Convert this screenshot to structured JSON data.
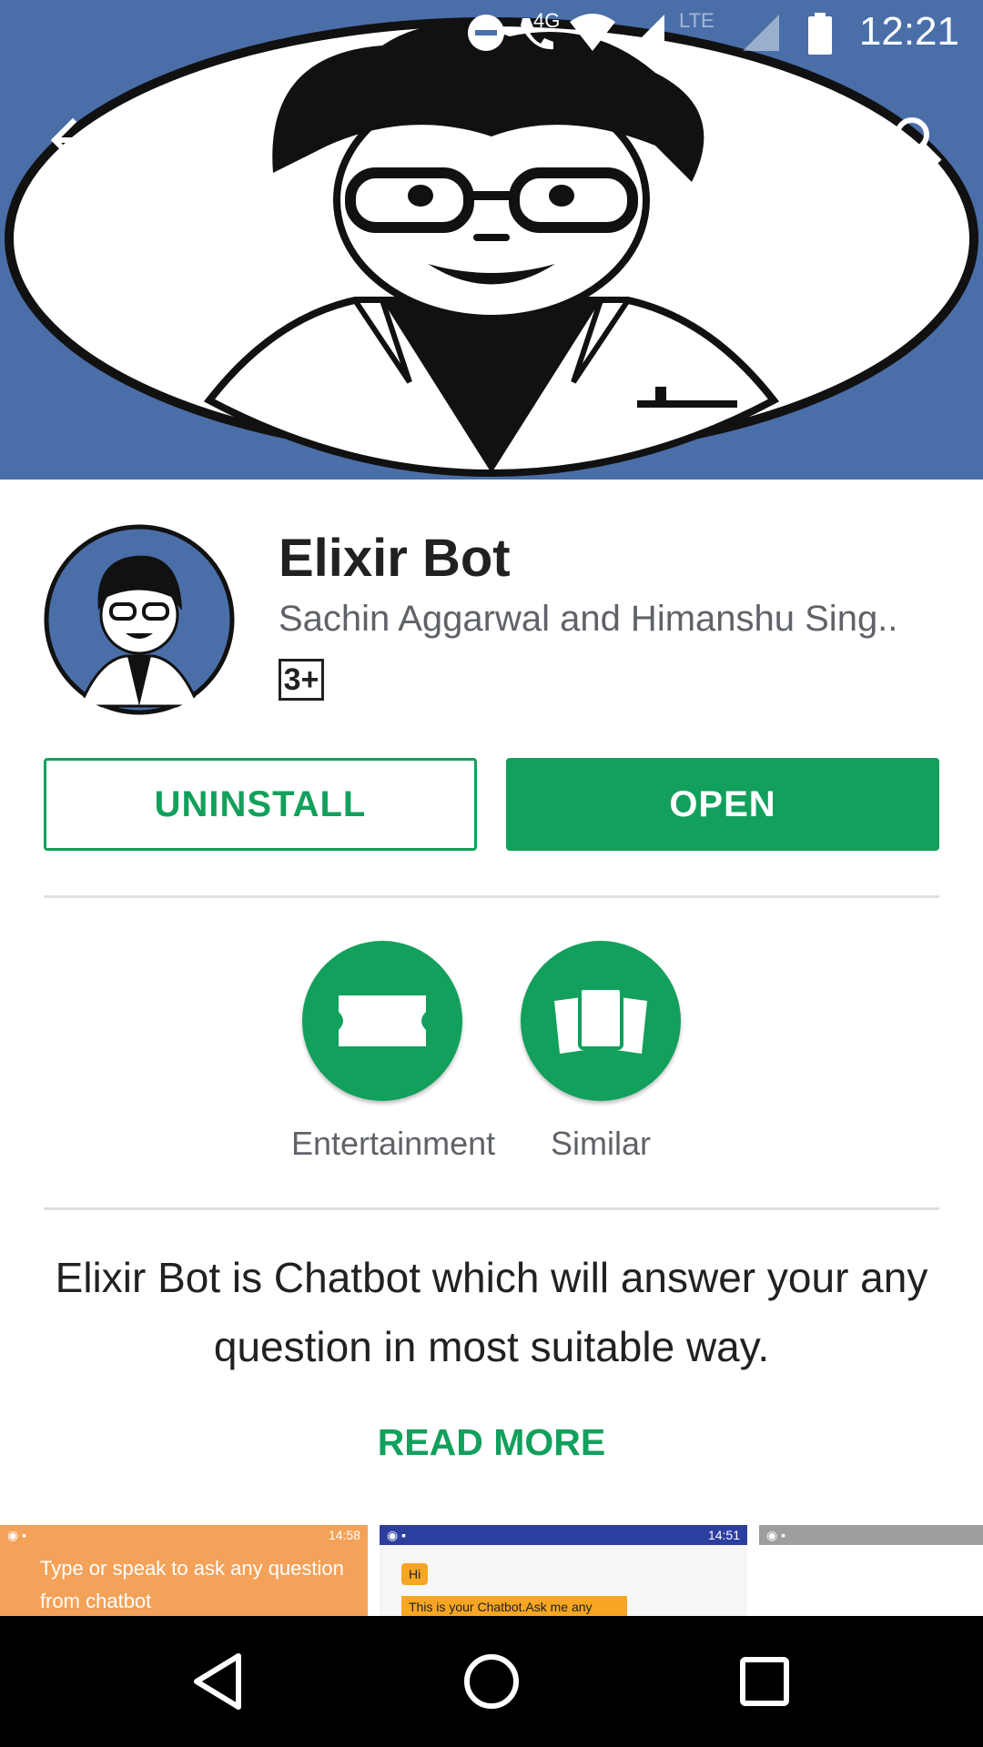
{
  "status_bar": {
    "time": "12:21",
    "network": "4G",
    "network2": "LTE"
  },
  "toolbar": {
    "back_icon": "arrow-left-icon",
    "search_icon": "search-icon"
  },
  "app": {
    "title": "Elixir Bot",
    "developer": "Sachin Aggarwal and Himanshu Sing..",
    "rating": "3+"
  },
  "actions": {
    "uninstall_label": "UNINSTALL",
    "open_label": "OPEN"
  },
  "chips": [
    {
      "label": "Entertainment",
      "icon": "ticket-icon"
    },
    {
      "label": "Similar",
      "icon": "cards-icon"
    }
  ],
  "description": "Elixir Bot is Chatbot which will answer your any question in most suitable way.",
  "read_more_label": "READ MORE",
  "screenshots": [
    {
      "time": "14:58",
      "text": "Type or speak to ask any question from chatbot"
    },
    {
      "time": "14:51",
      "bubble1": "Hi",
      "bubble2": "This is your Chatbot.Ask me any"
    }
  ],
  "colors": {
    "accent": "#12a05c",
    "banner": "#4a6ea8"
  }
}
